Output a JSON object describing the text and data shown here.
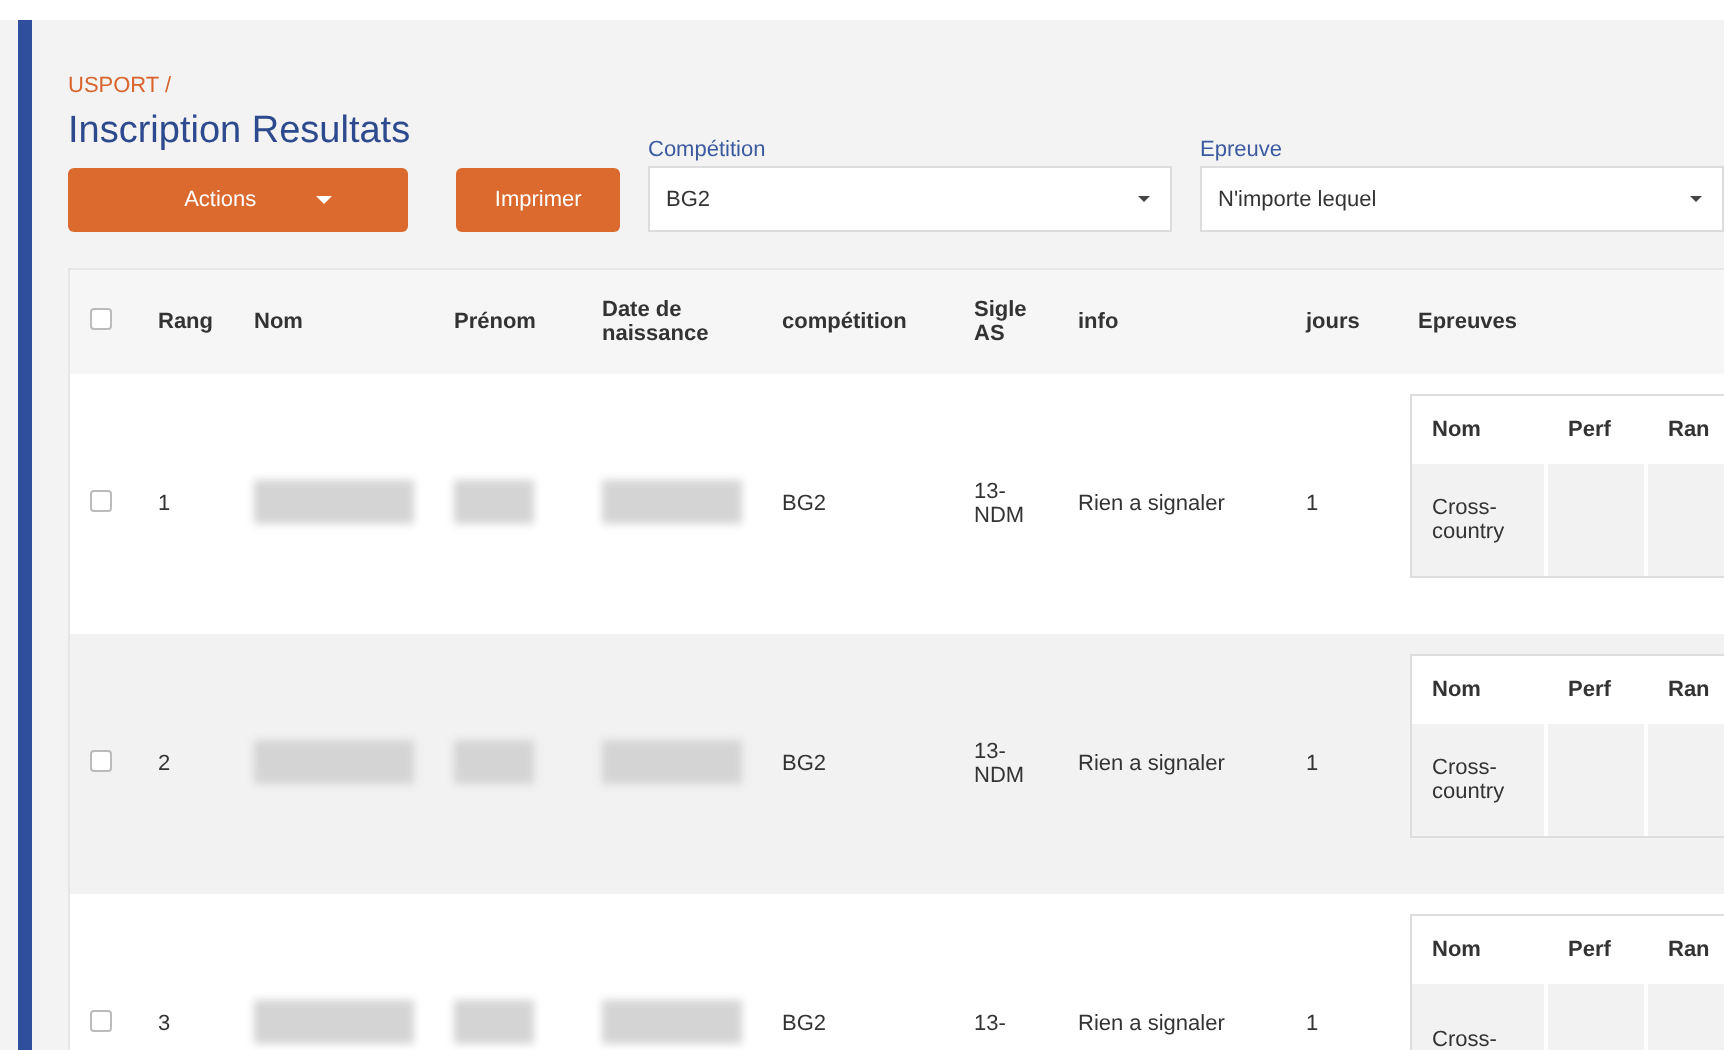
{
  "breadcrumb": "USPORT /",
  "title": "Inscription Resultats",
  "toolbar": {
    "actions_button": "Actions",
    "print_button": "Imprimer"
  },
  "filters": [
    {
      "label": "Compétition",
      "value": "BG2"
    },
    {
      "label": "Epreuve",
      "value": "N'importe lequel"
    }
  ],
  "table": {
    "select_all": {
      "checked": false
    },
    "columns": [
      "Rang",
      "Nom",
      "Prénom",
      "Date de naissance",
      "compétition",
      "Sigle AS",
      "info",
      "jours",
      "Epreuves"
    ],
    "rows": [
      {
        "checked": false,
        "rang": "1",
        "competition": "BG2",
        "sigle": "13-\nNDM",
        "info": "Rien a signaler",
        "jours": "1",
        "epreuves": {
          "columns": [
            "Nom",
            "Perf",
            "Ran"
          ],
          "rows": [
            [
              "Cross-\ncountry"
            ]
          ]
        }
      },
      {
        "checked": false,
        "rang": "2",
        "competition": "BG2",
        "sigle": "13-\nNDM",
        "info": "Rien a signaler",
        "jours": "1",
        "epreuves": {
          "columns": [
            "Nom",
            "Perf",
            "Ran"
          ],
          "rows": [
            [
              "Cross-\ncountry"
            ]
          ]
        }
      },
      {
        "checked": false,
        "rang": "3",
        "competition": "BG2",
        "sigle": "13-",
        "info": "Rien a signaler",
        "jours": "1",
        "epreuves": {
          "columns": [
            "Nom",
            "Perf",
            "Ran"
          ],
          "rows": [
            [
              "Cross-"
            ]
          ]
        }
      }
    ]
  }
}
